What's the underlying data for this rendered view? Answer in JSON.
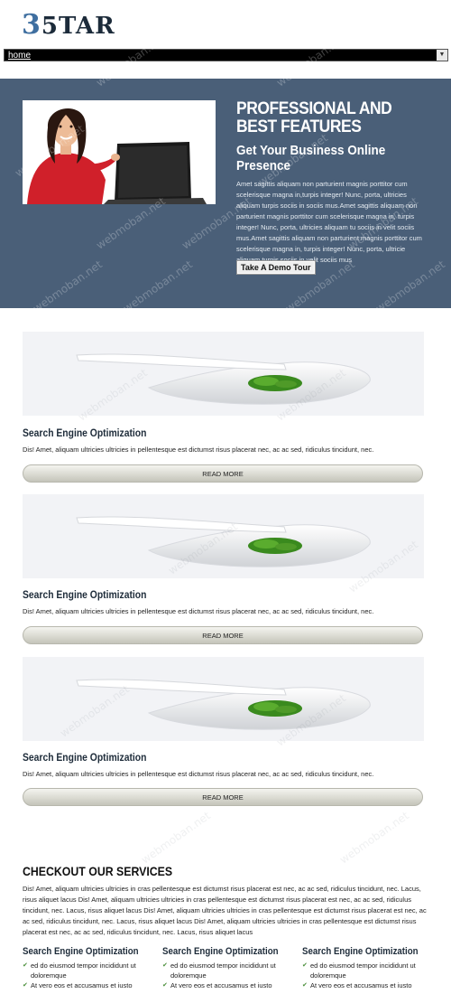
{
  "header": {
    "logo_num": "3",
    "logo_word": "5TAR"
  },
  "nav": {
    "selected": "home"
  },
  "hero": {
    "title": "PROFESSIONAL AND BEST FEATURES",
    "subtitle": "Get Your Business Online Presence",
    "body": "Amet sagittis aliquam non parturient magnis porttitor cum scelerisque magna in,turpis integer! Nunc, porta, ultricies aliquam turpis sociis in sociis mus.Amet sagittis aliquam non parturient magnis porttitor cum scelerisque magna in, turpis integer! Nunc, porta, ultricies aliquam tu sociis in velit sociis mus.Amet sagittis aliquam non parturient magnis porttitor cum scelerisque magna in, turpis integer! Nunc, porta, ultricie aliquam turpis sociis in velit sociis mus",
    "button": "Take A Demo Tour"
  },
  "features": [
    {
      "title": "Search Engine Optimization",
      "body": "Dis! Amet, aliquam ultricies ultricies in pellentesque est dictumst risus placerat nec, ac ac sed, ridiculus tincidunt, nec.",
      "button": "READ MORE"
    },
    {
      "title": "Search Engine Optimization",
      "body": "Dis! Amet, aliquam ultricies ultricies in pellentesque est dictumst risus placerat nec, ac ac sed, ridiculus tincidunt, nec.",
      "button": "READ MORE"
    },
    {
      "title": "Search Engine Optimization",
      "body": "Dis! Amet, aliquam ultricies ultricies in pellentesque est dictumst risus placerat nec, ac ac sed, ridiculus tincidunt, nec.",
      "button": "READ MORE"
    }
  ],
  "services": {
    "title": "CHECKOUT OUR SERVICES",
    "body": "Dis! Amet, aliquam ultricies ultricies in cras pellentesque est dictumst risus placerat est nec, ac ac sed, ridiculus tincidunt, nec. Lacus, risus aliquet lacus Dis! Amet, aliquam ultricies ultricies in cras pellentesque est dictumst risus placerat est nec, ac ac sed, ridiculus tincidunt, nec. Lacus, risus aliquet lacus Dis! Amet, aliquam ultricies ultricies in cras pellentesque est dictumst risus placerat est nec, ac ac sed, ridiculus tincidunt, nec. Lacus, risus aliquet lacus Dis! Amet, aliquam ultricies ultricies in cras pellentesque est dictumst risus placerat est nec, ac ac sed, ridiculus tincidunt, nec. Lacus, risus aliquet lacus",
    "columns": [
      {
        "title": "Search Engine Optimization",
        "items": [
          "ed do eiusmod tempor incididunt ut doloremque",
          "At vero eos et accusamus et iusto"
        ]
      },
      {
        "title": "Search Engine Optimization",
        "items": [
          "ed do eiusmod tempor incididunt ut doloremque",
          "At vero eos et accusamus et iusto"
        ]
      },
      {
        "title": "Search Engine Optimization",
        "items": [
          "ed do eiusmod tempor incididunt ut doloremque",
          "At vero eos et accusamus et iusto"
        ]
      }
    ]
  },
  "watermark": "webmoban.net",
  "colors": {
    "hero_bg": "#4a5f78",
    "logo_accent": "#3f6fa0",
    "check": "#4a8f3a"
  },
  "icons": {
    "check": "check-icon",
    "dropdown": "chevron-down-icon"
  }
}
